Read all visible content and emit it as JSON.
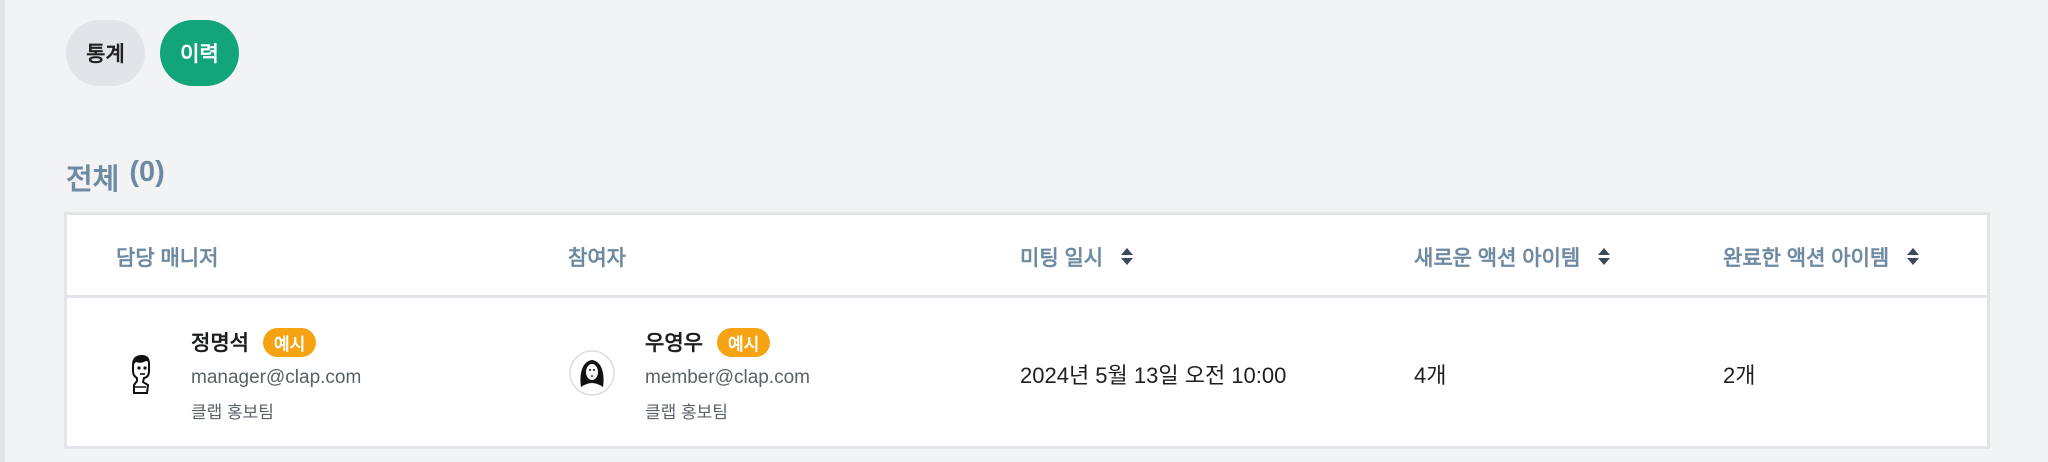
{
  "tabs": [
    {
      "label": "통계",
      "active": false
    },
    {
      "label": "이력",
      "active": true
    }
  ],
  "section": {
    "title": "전체",
    "count": "(0)"
  },
  "table": {
    "headers": {
      "manager": "담당 매니저",
      "participant": "참여자",
      "meeting_datetime": "미팅 일시",
      "new_action_items": "새로운 액션 아이템",
      "completed_action_items": "완료한 액션 아이템"
    },
    "rows": [
      {
        "manager": {
          "name": "정명석",
          "badge": "예시",
          "email": "manager@clap.com",
          "team": "클랩 홍보팀"
        },
        "participant": {
          "name": "우영우",
          "badge": "예시",
          "email": "member@clap.com",
          "team": "클랩 홍보팀"
        },
        "meeting_datetime": "2024년 5월 13일 오전 10:00",
        "new_action_items": "4개",
        "completed_action_items": "2개"
      }
    ]
  },
  "colors": {
    "accent": "#13a57a",
    "badge": "#f6a313",
    "header_text": "#6e8aa2"
  }
}
